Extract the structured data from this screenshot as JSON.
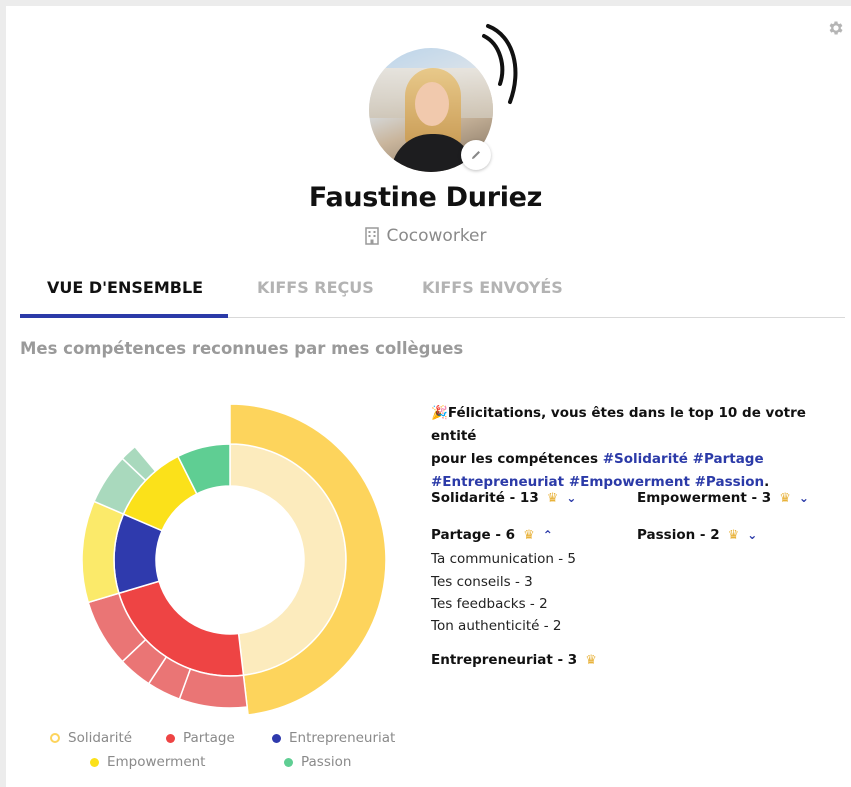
{
  "profile": {
    "name": "Faustine Duriez",
    "company": "Cocoworker"
  },
  "tabs": [
    {
      "label": "VUE D'ENSEMBLE",
      "active": true
    },
    {
      "label": "KIFFS REÇUS",
      "active": false
    },
    {
      "label": "KIFFS ENVOYÉS",
      "active": false
    }
  ],
  "section": {
    "title": "Mes compétences reconnues par mes collègues"
  },
  "congrats": {
    "emoji": "🎉",
    "line1": "Félicitations, vous êtes dans le top 10 de votre entité",
    "line2_prefix": "pour les compétences ",
    "tags_line2": "#Solidarité #Partage",
    "tags_line3": "#Entrepreneuriat #Empowerment #Passion",
    "suffix": "."
  },
  "skills": {
    "solidarite": "Solidarité - 13",
    "partage": "Partage - 6",
    "entrepreneuriat": "Entrepreneuriat - 3",
    "empowerment": "Empowerment - 3",
    "passion": "Passion - 2"
  },
  "partage_details": [
    "Ta communication - 5",
    "Tes conseils - 3",
    "Tes feedbacks - 2",
    "Ton authenticité - 2"
  ],
  "legend": [
    {
      "label": "Solidarité",
      "color": "#fdd45c"
    },
    {
      "label": "Partage",
      "color": "#ee4444"
    },
    {
      "label": "Entrepreneuriat",
      "color": "#2f3aad"
    },
    {
      "label": "Empowerment",
      "color": "#fbe11a"
    },
    {
      "label": "Passion",
      "color": "#5fce93"
    }
  ],
  "chart_data": {
    "type": "pie",
    "variant": "sunburst",
    "inner": [
      {
        "name": "Solidarité",
        "value": 13,
        "color": "#fcebbd"
      },
      {
        "name": "Partage",
        "value": 6,
        "color": "#ee4444"
      },
      {
        "name": "Entrepreneuriat",
        "value": 3,
        "color": "#2f3aad"
      },
      {
        "name": "Empowerment",
        "value": 3,
        "color": "#fbe11a"
      },
      {
        "name": "Passion",
        "value": 2,
        "color": "#5fce93"
      }
    ],
    "outer": [
      {
        "parent": "Solidarité",
        "value": 13,
        "color": "#fdd45c"
      },
      {
        "parent": "Partage",
        "value": 2,
        "color": "#ea7575"
      },
      {
        "parent": "Partage",
        "value": 1,
        "color": "#ea7575"
      },
      {
        "parent": "Partage",
        "value": 1,
        "color": "#ea7575"
      },
      {
        "parent": "Partage",
        "value": 2,
        "color": "#ea7575"
      },
      {
        "parent": "Empowerment",
        "value": 3,
        "color": "#fbea6a"
      },
      {
        "parent": "Passion",
        "value": 1.5,
        "color": "#a9d9bd"
      },
      {
        "parent": "Passion",
        "value": 0.5,
        "color": "#a9d9bd"
      }
    ],
    "total": 27
  }
}
